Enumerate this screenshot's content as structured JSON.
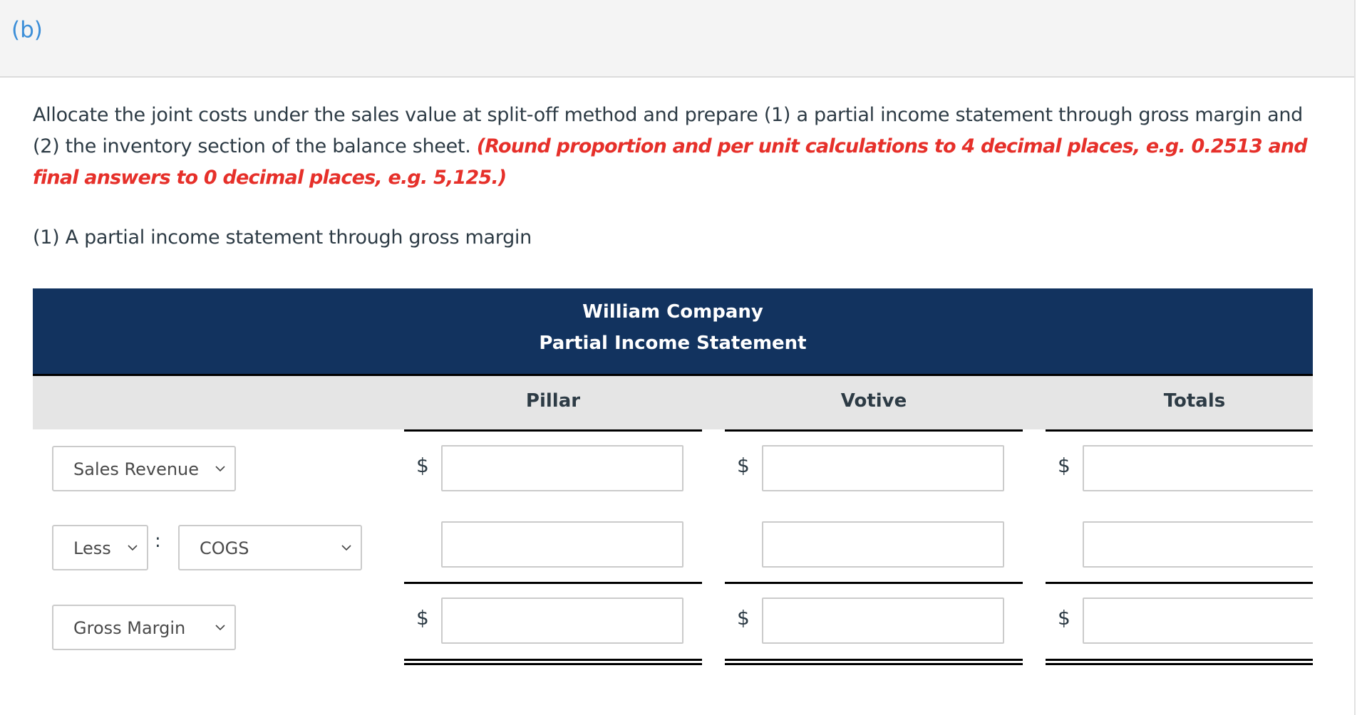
{
  "part": {
    "label": "(b)"
  },
  "instructions": {
    "text": "Allocate the joint costs under the sales value at split-off method and prepare (1) a partial income statement through gross margin and (2) the inventory section of the balance sheet. ",
    "hint": "(Round proportion and per unit calculations to 4 decimal places, e.g. 0.2513 and final answers to 0 decimal places, e.g. 5,125.)"
  },
  "subheading": "(1) A partial income statement through gross margin",
  "statement": {
    "company": "William Company",
    "title": "Partial Income Statement",
    "columns": [
      "Pillar",
      "Votive",
      "Totals"
    ],
    "rows": [
      {
        "label_select": "Sales Revenue",
        "currency": "$",
        "values": [
          "",
          "",
          ""
        ]
      },
      {
        "prefix_select": "Less",
        "separator": ":",
        "label_select": "COGS",
        "currency": "",
        "values": [
          "",
          "",
          ""
        ]
      },
      {
        "label_select": "Gross Margin",
        "currency": "$",
        "values": [
          "",
          "",
          ""
        ]
      }
    ]
  },
  "colors": {
    "header_bg": "#12335f",
    "accent_blue": "#3b8ed8",
    "hint_red": "#e6302a",
    "column_header_bg": "#e5e5e5"
  }
}
